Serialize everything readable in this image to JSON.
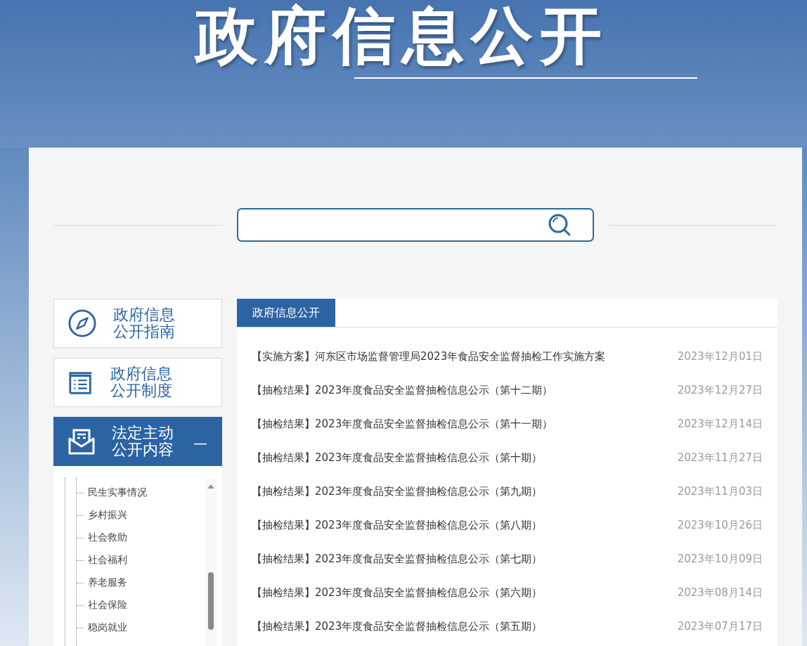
{
  "banner": {
    "title": "政府信息公开"
  },
  "sidebar": {
    "items": [
      {
        "kind": "compass",
        "line1": "政府信息",
        "line2": "公开指南",
        "selected": false
      },
      {
        "kind": "list",
        "line1": "政府信息",
        "line2": "公开制度",
        "selected": false
      },
      {
        "kind": "mail",
        "line1": "法定主动",
        "line2": "公开内容",
        "selected": true,
        "toggle": "—"
      }
    ],
    "tree_items": [
      "民生实事情况",
      "乡村振兴",
      "社会救助",
      "社会福利",
      "养老服务",
      "社会保险",
      "稳岗就业"
    ]
  },
  "main": {
    "tab": "政府信息公开",
    "rows": [
      {
        "title": "【实施方案】河东区市场监督管理局2023年食品安全监督抽检工作实施方案",
        "date": "2023年12月01日"
      },
      {
        "title": "【抽检结果】2023年度食品安全监督抽检信息公示（第十二期）",
        "date": "2023年12月27日"
      },
      {
        "title": "【抽检结果】2023年度食品安全监督抽检信息公示（第十一期）",
        "date": "2023年12月14日"
      },
      {
        "title": "【抽检结果】2023年度食品安全监督抽检信息公示（第十期）",
        "date": "2023年11月27日"
      },
      {
        "title": "【抽检结果】2023年度食品安全监督抽检信息公示（第九期）",
        "date": "2023年11月03日"
      },
      {
        "title": "【抽检结果】2023年度食品安全监督抽检信息公示（第八期）",
        "date": "2023年10月26日"
      },
      {
        "title": "【抽检结果】2023年度食品安全监督抽检信息公示（第七期）",
        "date": "2023年10月09日"
      },
      {
        "title": "【抽检结果】2023年度食品安全监督抽检信息公示（第六期）",
        "date": "2023年08月14日"
      },
      {
        "title": "【抽检结果】2023年度食品安全监督抽检信息公示（第五期）",
        "date": "2023年07月17日"
      }
    ]
  }
}
